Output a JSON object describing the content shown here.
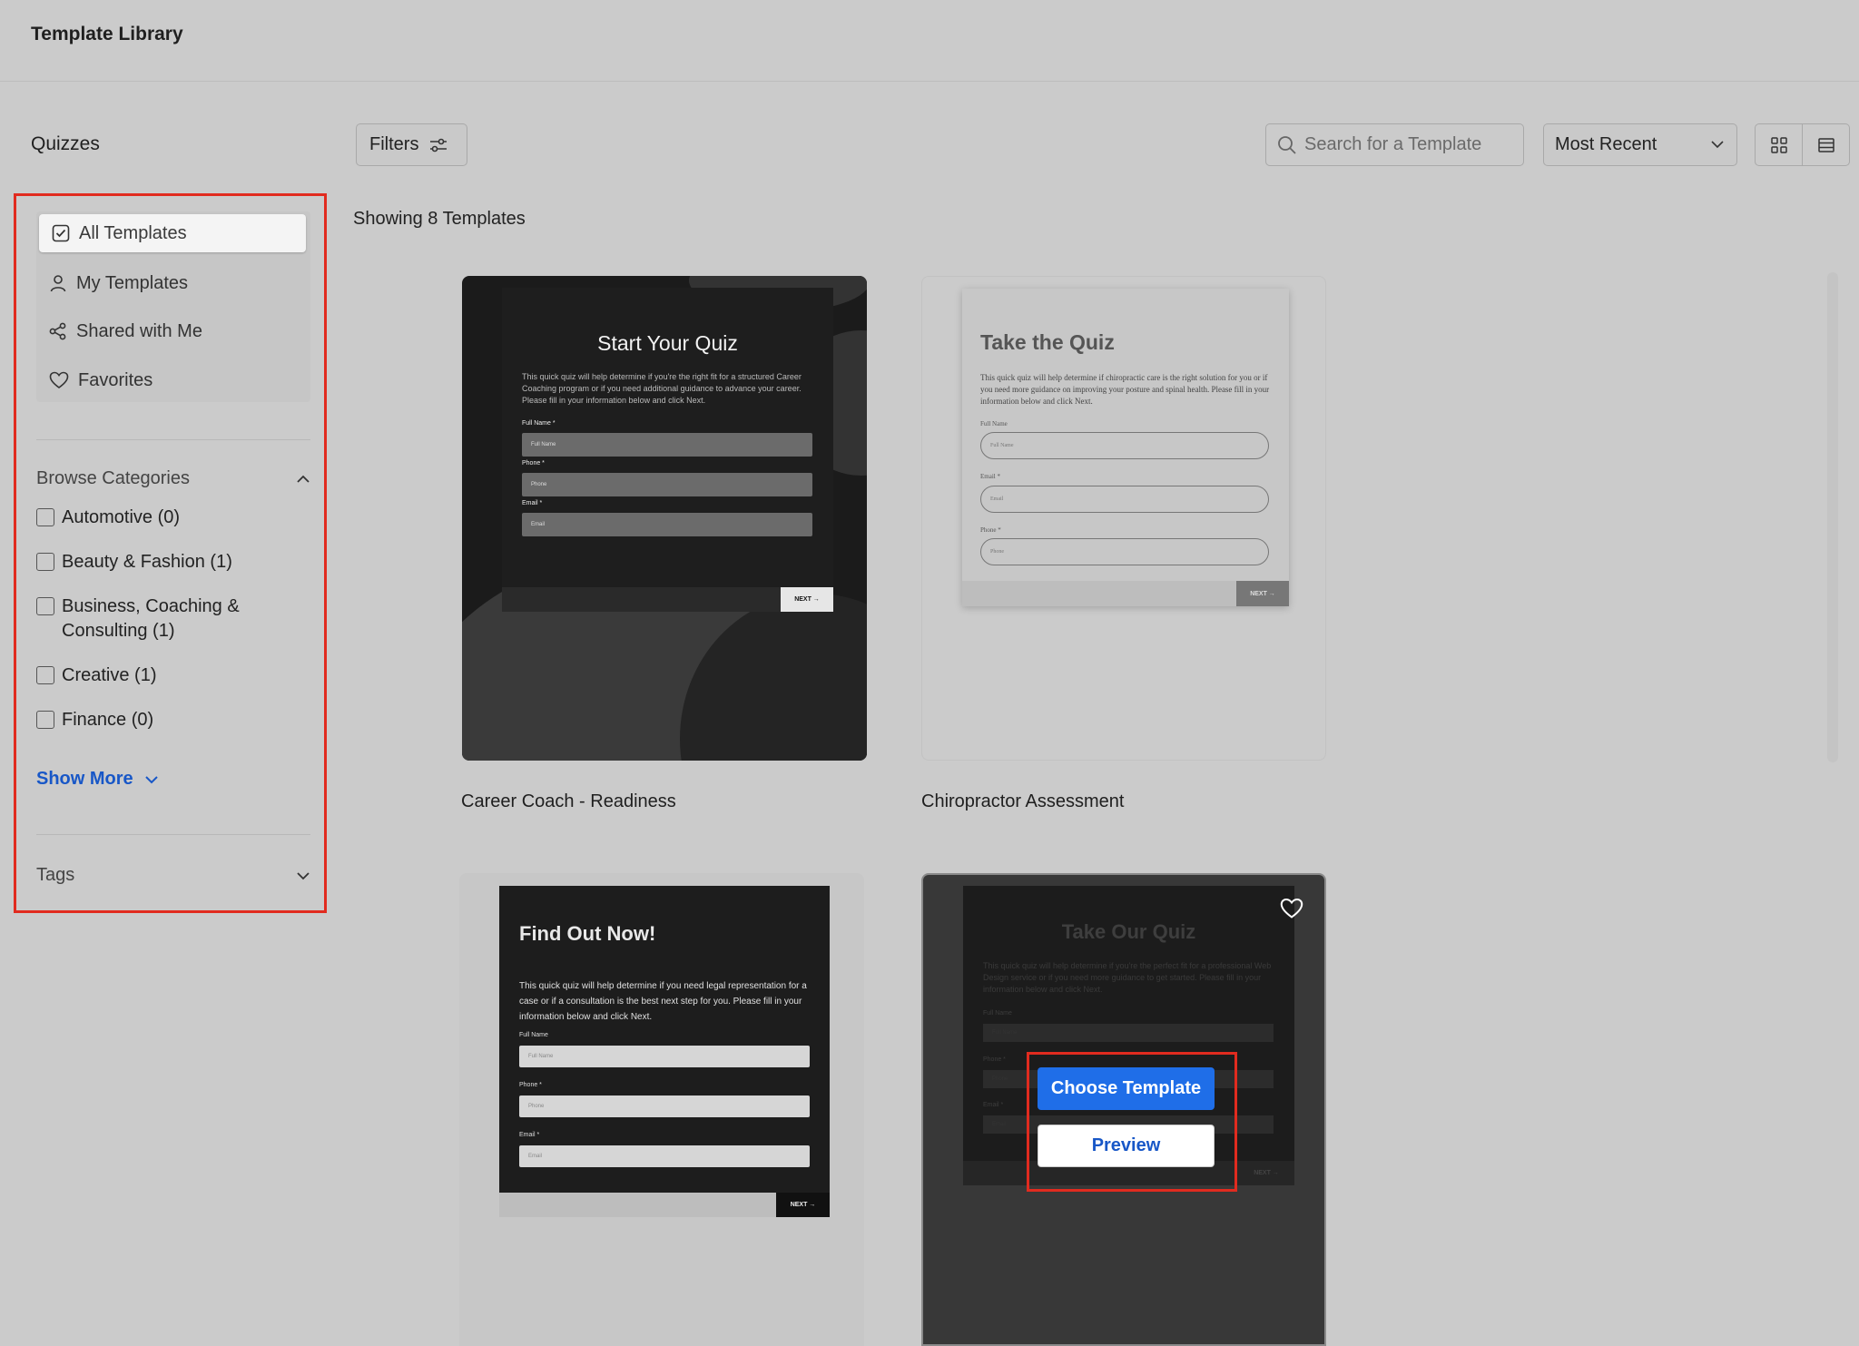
{
  "header": {
    "title": "Template Library"
  },
  "section": {
    "title": "Quizzes"
  },
  "toolbar": {
    "filters_label": "Filters",
    "search_placeholder": "Search for a Template",
    "sort_value": "Most Recent"
  },
  "sidebar": {
    "nav": [
      {
        "label": "All Templates",
        "icon": "checkbox-icon",
        "active": true
      },
      {
        "label": "My Templates",
        "icon": "user-icon"
      },
      {
        "label": "Shared with Me",
        "icon": "share-icon"
      },
      {
        "label": "Favorites",
        "icon": "heart-icon"
      }
    ],
    "categories_title": "Browse Categories",
    "categories": [
      "Automotive (0)",
      "Beauty & Fashion (1)",
      "Business, Coaching & Consulting (1)",
      "Creative (1)",
      "Finance (0)"
    ],
    "show_more": "Show More",
    "tags_title": "Tags"
  },
  "results": {
    "count_text": "Showing 8 Templates"
  },
  "cards": [
    {
      "name": "Career Coach - Readiness",
      "preview": {
        "heading": "Start Your Quiz",
        "description": "This quick quiz will help determine if you're the right fit for a structured Career Coaching program or if you need additional guidance to advance your career. Please fill in your information below and click Next.",
        "fields": [
          {
            "label": "Full Name *",
            "placeholder": "Full Name"
          },
          {
            "label": "Phone *",
            "placeholder": "Phone"
          },
          {
            "label": "Email *",
            "placeholder": "Email"
          }
        ],
        "next": "NEXT →"
      }
    },
    {
      "name": "Chiropractor Assessment",
      "preview": {
        "heading": "Take the Quiz",
        "description": "This quick quiz will help determine if chiropractic care is the right solution for you or if you need more guidance on improving your posture and spinal health. Please fill in your information below and click Next.",
        "fields": [
          {
            "label": "Full Name",
            "placeholder": "Full Name"
          },
          {
            "label": "Email *",
            "placeholder": "Email"
          },
          {
            "label": "Phone *",
            "placeholder": "Phone"
          }
        ],
        "next": "NEXT →"
      }
    },
    {
      "name": "",
      "preview": {
        "heading": "Find Out Now!",
        "description": "This quick quiz will help determine if you need legal representation for a case or if a consultation is the best next step for you. Please fill in your information below and click Next.",
        "fields": [
          {
            "label": "Full Name",
            "placeholder": "Full Name"
          },
          {
            "label": "Phone *",
            "placeholder": "Phone"
          },
          {
            "label": "Email *",
            "placeholder": "Email"
          }
        ],
        "next": "NEXT →"
      }
    },
    {
      "name": "",
      "preview": {
        "heading": "Take Our Quiz",
        "description": "This quick quiz will help determine if you're the perfect fit for a professional Web Design service or if you need more guidance to get started. Please fill in your information below and click Next.",
        "fields": [
          {
            "label": "Full Name",
            "placeholder": "Full Name"
          },
          {
            "label": "Phone *",
            "placeholder": "Phone"
          },
          {
            "label": "Email *",
            "placeholder": "Email"
          }
        ],
        "next": "NEXT →"
      },
      "hover_actions": {
        "choose": "Choose Template",
        "preview": "Preview"
      }
    }
  ],
  "colors": {
    "accent": "#1f6ee8",
    "highlight": "#e12b1f",
    "link": "#1857c7"
  }
}
